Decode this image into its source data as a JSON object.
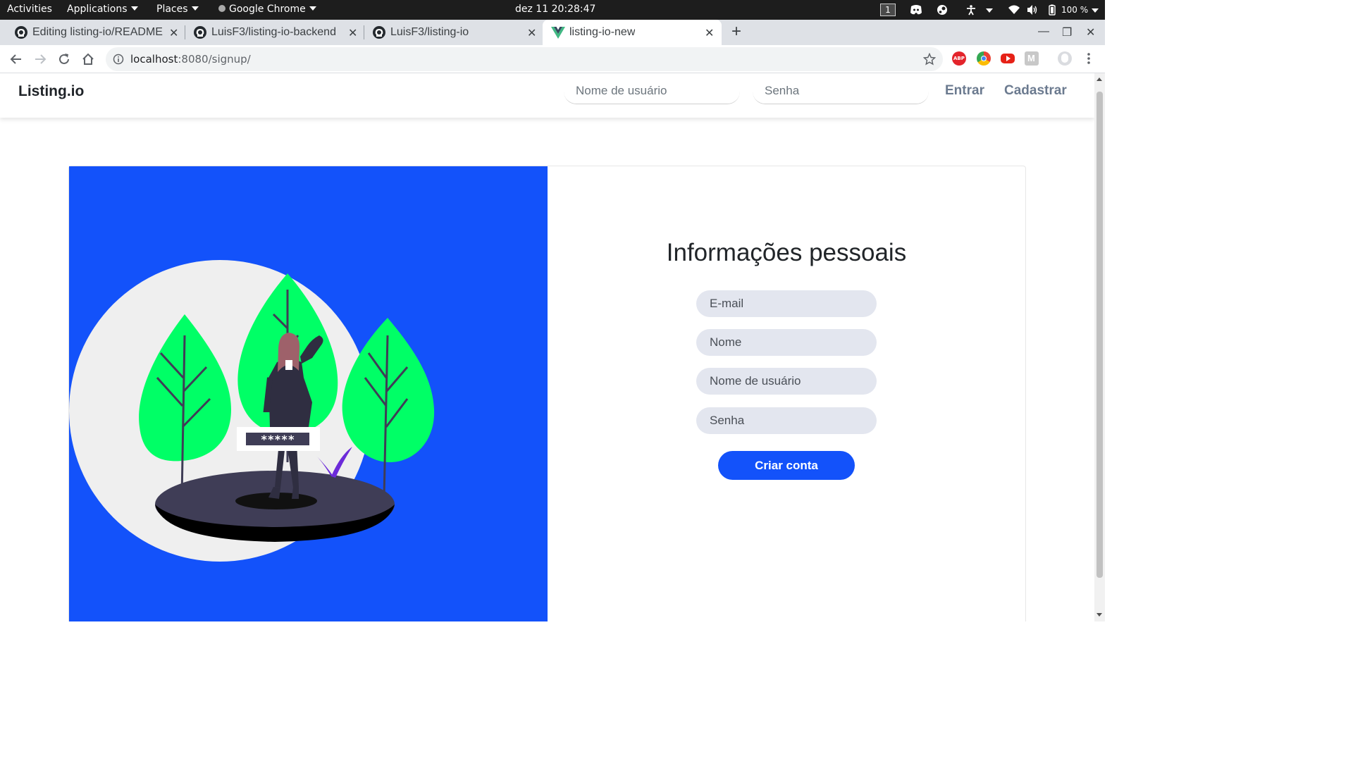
{
  "topbar": {
    "activities": "Activities",
    "applications": "Applications",
    "places": "Places",
    "app_name": "Google Chrome",
    "clock": "dez 11  20:28:47",
    "workspace": "1",
    "battery": "100 %"
  },
  "tabs": [
    {
      "label": "Editing listing-io/README",
      "icon": "github-icon"
    },
    {
      "label": "LuisF3/listing-io-backend",
      "icon": "github-icon"
    },
    {
      "label": "LuisF3/listing-io",
      "icon": "github-icon"
    },
    {
      "label": "listing-io-new",
      "icon": "vue-icon",
      "active": true
    }
  ],
  "toolbar": {
    "url_host": "localhost",
    "url_path": ":8080/signup/"
  },
  "navbar": {
    "brand": "Listing.io",
    "username_placeholder": "Nome de usuário",
    "password_placeholder": "Senha",
    "login_label": "Entrar",
    "signup_label": "Cadastrar"
  },
  "form": {
    "title": "Informações pessoais",
    "email_placeholder": "E-mail",
    "name_placeholder": "Nome",
    "username_placeholder": "Nome de usuário",
    "password_placeholder": "Senha",
    "submit_label": "Criar conta"
  },
  "illustration": {
    "password_mask": "*****"
  },
  "colors": {
    "accent": "#1352fa",
    "leaf": "#00ff66",
    "dark": "#3f3d56"
  }
}
